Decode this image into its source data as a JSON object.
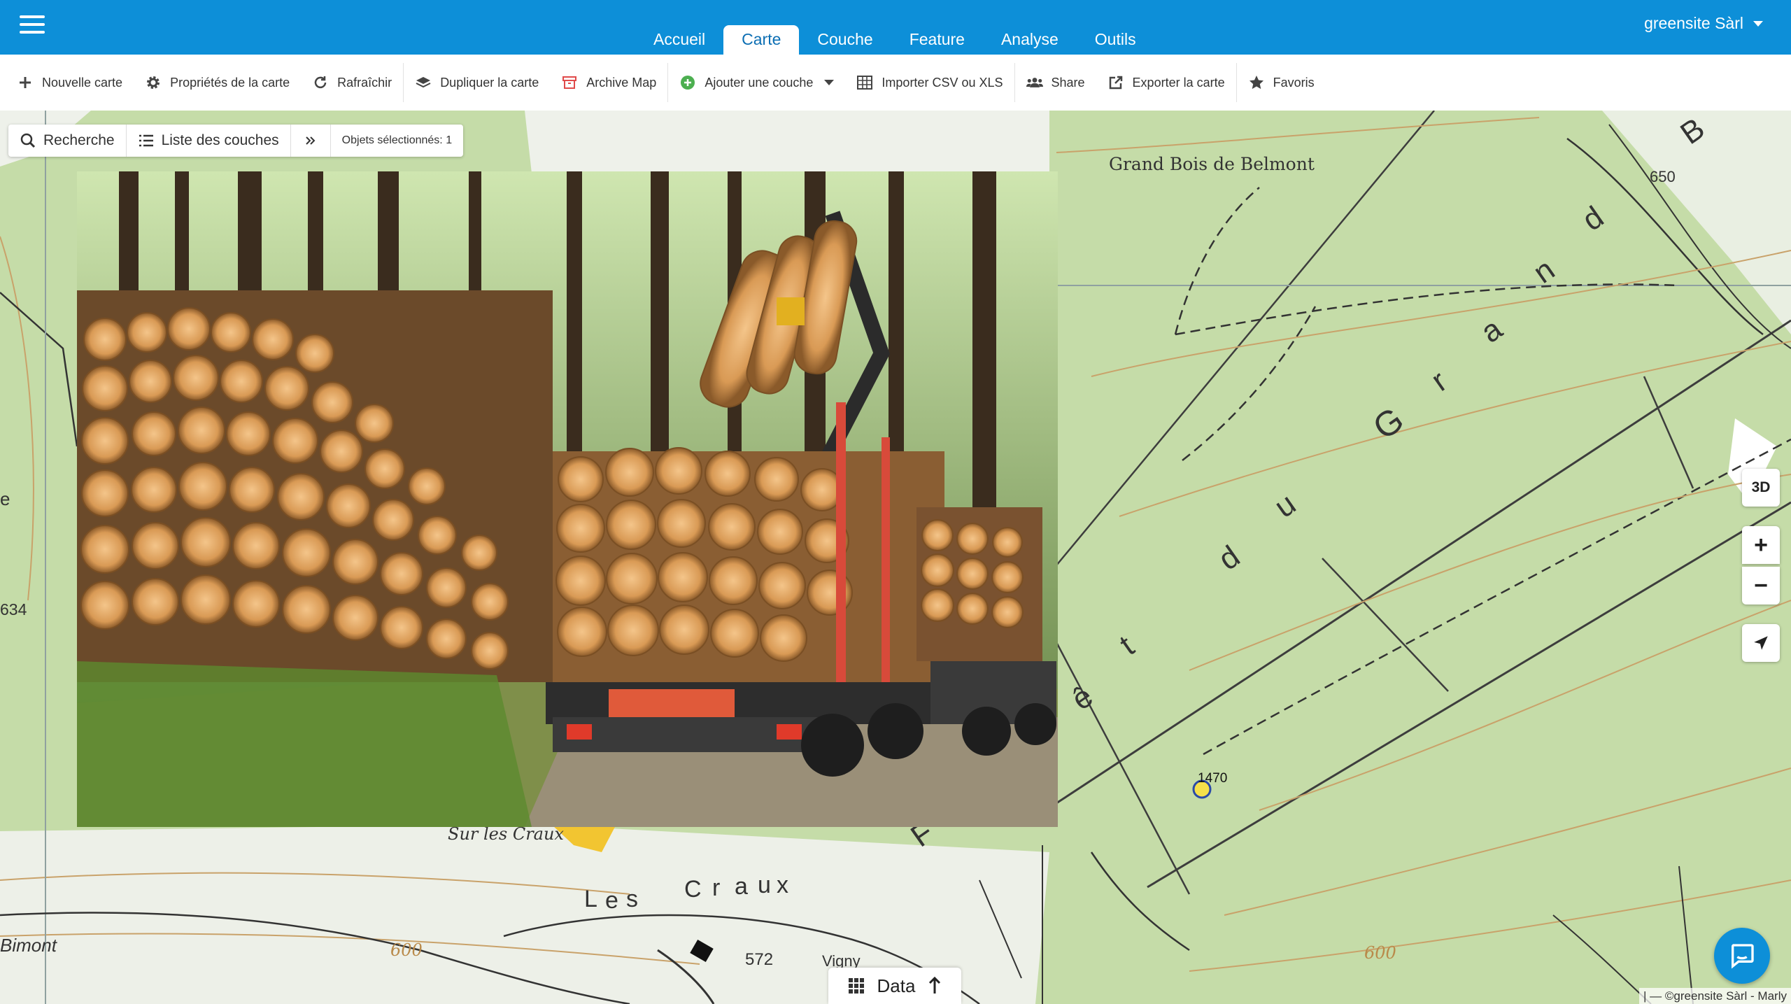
{
  "topbar": {
    "tabs": [
      {
        "label": "Accueil",
        "active": false
      },
      {
        "label": "Carte",
        "active": true
      },
      {
        "label": "Couche",
        "active": false
      },
      {
        "label": "Feature",
        "active": false
      },
      {
        "label": "Analyse",
        "active": false
      },
      {
        "label": "Outils",
        "active": false
      }
    ],
    "user": "greensite Sàrl",
    "colors": {
      "bar": "#0d8fd8",
      "accent": "#0d6fb4"
    }
  },
  "toolbar": {
    "new_map": "Nouvelle carte",
    "map_properties": "Propriétés de la carte",
    "refresh": "Rafraîchir",
    "duplicate": "Dupliquer la carte",
    "archive": "Archive Map",
    "add_layer": "Ajouter une couche",
    "import_csv": "Importer CSV ou XLS",
    "share": "Share",
    "export": "Exporter la carte",
    "favorites": "Favoris"
  },
  "map_controls": {
    "search": "Recherche",
    "layer_list": "Liste des couches",
    "expand_icon": "double-chevron-right-icon",
    "selected": "Objets sélectionnés: 1"
  },
  "map": {
    "labels": {
      "wood": "Grand Bois de Belmont",
      "forest_letters": [
        "ê",
        "t",
        "d",
        "u",
        "G",
        "r",
        "a",
        "n",
        "d",
        "B"
      ],
      "forest_start": "F",
      "sur_les_craux": "Sur les Craux",
      "les_craux": [
        "L",
        "e",
        "s",
        "C",
        "r",
        "a",
        "u",
        "x"
      ],
      "belmont": "Bimont",
      "vigny": "Vigny",
      "alt_650": "650",
      "alt_634": "634",
      "alt_600_left": "600",
      "alt_600_right": "600",
      "alt_572": "572",
      "edge_e": "e",
      "marker_label": "1470"
    }
  },
  "zoom": {
    "btn_3d": "3D",
    "plus": "+",
    "minus": "−",
    "locate_icon": "navigation-arrow-icon"
  },
  "bottom": {
    "data_tab": "Data",
    "chat_icon": "chat-icon"
  },
  "attribution": "| — ©greensite Sàrl - Marly"
}
